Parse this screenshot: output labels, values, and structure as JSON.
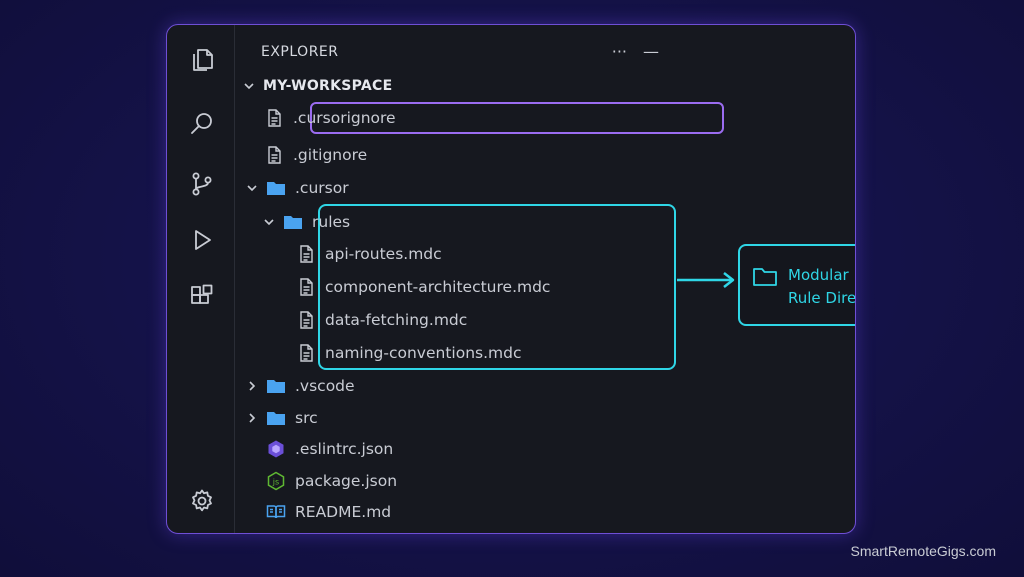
{
  "panel": {
    "title": "EXPLORER",
    "more_actions_label": "···",
    "collapse_label": "—"
  },
  "tree": {
    "workspace": "MY-WORKSPACE",
    "items": {
      "cursorignore": ".cursorignore",
      "gitignore": ".gitignore",
      "cursor_folder": ".cursor",
      "rules_folder": "rules",
      "api_routes": "api-routes.mdc",
      "component_architecture": "component-architecture.mdc",
      "data_fetching": "data-fetching.mdc",
      "naming_conventions": "naming-conventions.mdc",
      "vscode_folder": ".vscode",
      "src_folder": "src",
      "eslintrc": ".eslintrc.json",
      "package_json": "package.json",
      "readme": "README.md"
    }
  },
  "callout": {
    "line1": "Modular .mdc",
    "line2": "Rule Directory."
  },
  "watermark": "SmartRemoteGigs.com",
  "colors": {
    "highlight_purple": "#9b6cf0",
    "highlight_cyan": "#2fd6e6",
    "folder_blue": "#4aa3f0",
    "window_border": "#6f4fd6"
  },
  "icons": {
    "activity": [
      "files-icon",
      "search-icon",
      "source-control-icon",
      "run-debug-icon",
      "extensions-icon",
      "settings-gear-icon"
    ]
  }
}
